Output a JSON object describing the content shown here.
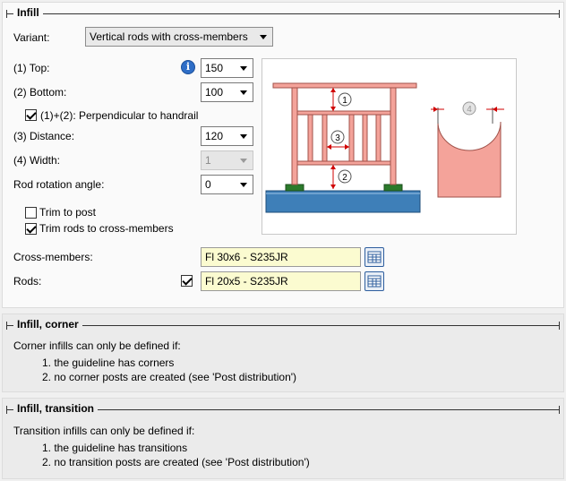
{
  "infill": {
    "title": "Infill",
    "variant_label": "Variant:",
    "variant_value": "Vertical rods with cross-members",
    "top_label": "(1) Top:",
    "top_value": "150",
    "bottom_label": "(2) Bottom:",
    "bottom_value": "100",
    "perpendicular_label": "(1)+(2): Perpendicular to handrail",
    "perpendicular_checked": true,
    "distance_label": "(3) Distance:",
    "distance_value": "120",
    "width_label": "(4) Width:",
    "width_value": "1",
    "rotation_label": "Rod rotation angle:",
    "rotation_value": "0",
    "trim_post_label": "Trim to post",
    "trim_post_checked": false,
    "trim_rods_label": "Trim rods to cross-members",
    "trim_rods_checked": true,
    "cross_members_label": "Cross-members:",
    "cross_members_value": "Fl 30x6 - S235JR",
    "rods_label": "Rods:",
    "rods_checked": true,
    "rods_value": "Fl 20x5 - S235JR",
    "diagram_markers": [
      "1",
      "2",
      "3",
      "4"
    ]
  },
  "corner": {
    "title": "Infill, corner",
    "intro": "Corner infills can only be defined if:",
    "items": [
      "1. the guideline has corners",
      "2. no corner posts are created (see 'Post distribution')"
    ]
  },
  "transition": {
    "title": "Infill, transition",
    "intro": "Transition infills can only be defined if:",
    "items": [
      "1. the guideline has transitions",
      "2. no transition posts are created (see 'Post distribution')"
    ]
  },
  "icons": {
    "info": "info-icon",
    "profile_catalog": "profile-catalog-icon",
    "dropdown": "chevron-down-icon"
  },
  "colors": {
    "rail": "#f4a39a",
    "rail_stroke": "#a0524a",
    "concrete": "#3e7fb8",
    "profile_field": "#fbfbd0"
  }
}
